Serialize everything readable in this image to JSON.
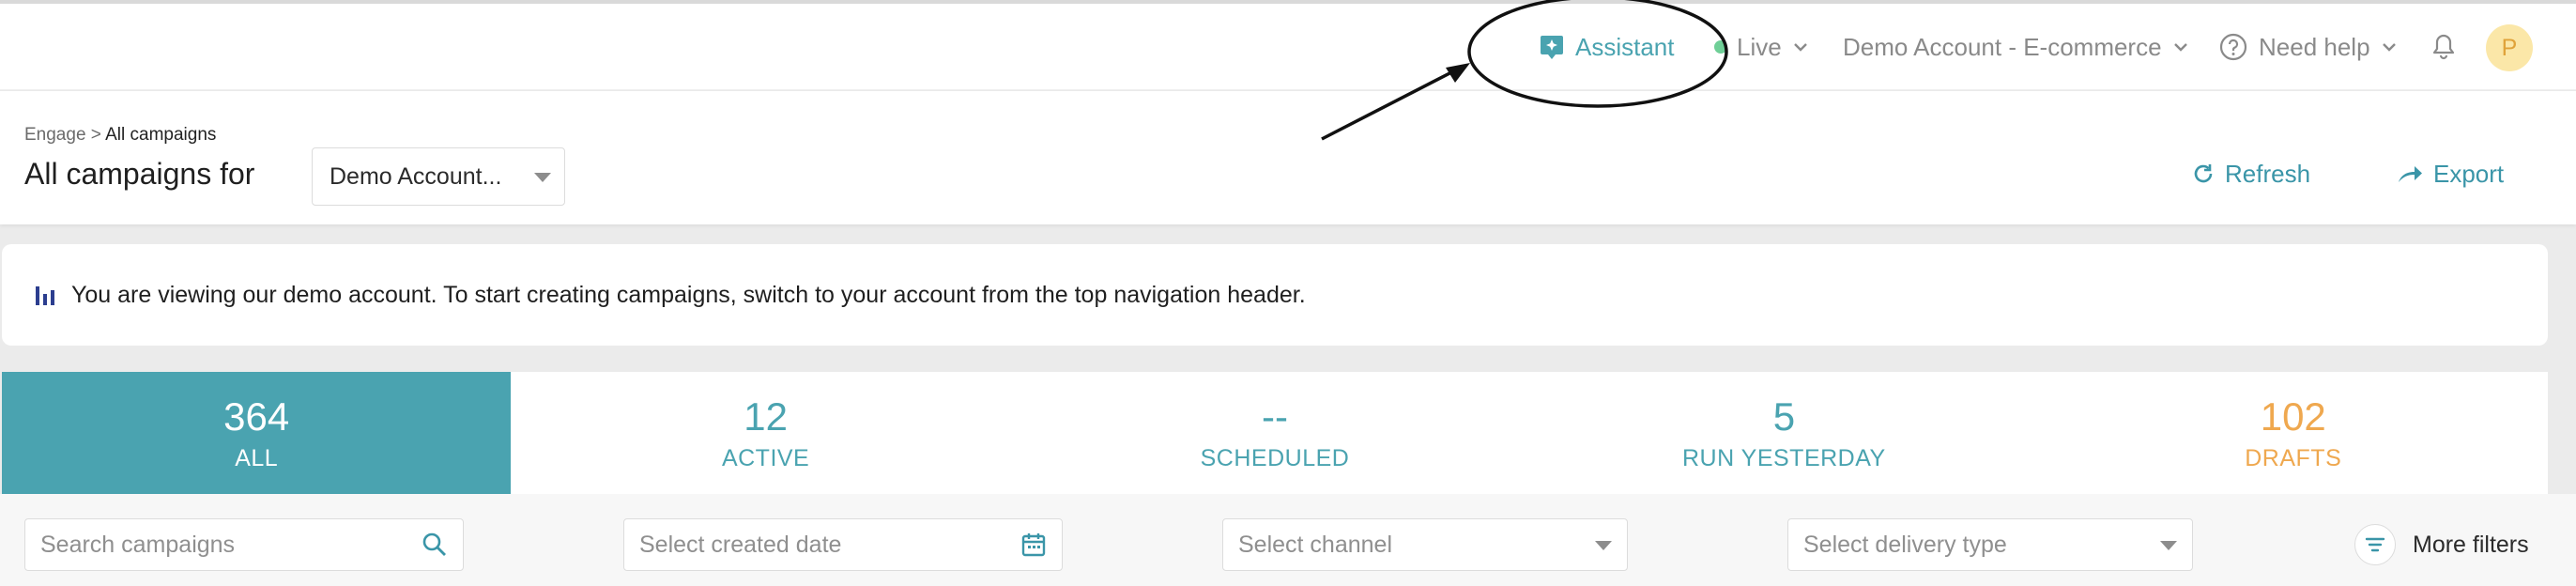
{
  "topbar": {
    "assistant_label": "Assistant",
    "live_label": "Live",
    "account_label": "Demo Account - E-commerce",
    "help_label": "Need help",
    "avatar_initial": "P"
  },
  "subheader": {
    "breadcrumb_parent": "Engage >",
    "breadcrumb_current": "All campaigns",
    "title": "All campaigns for",
    "account_select_value": "Demo Account...",
    "refresh_label": "Refresh",
    "export_label": "Export"
  },
  "banner": {
    "text": "You are viewing our demo account. To start creating campaigns, switch to your account from the top navigation header."
  },
  "stats": [
    {
      "value": "364",
      "label": "ALL"
    },
    {
      "value": "12",
      "label": "ACTIVE"
    },
    {
      "value": "--",
      "label": "SCHEDULED"
    },
    {
      "value": "5",
      "label": "RUN YESTERDAY"
    },
    {
      "value": "102",
      "label": "DRAFTS"
    }
  ],
  "filters": {
    "search_placeholder": "Search campaigns",
    "date_placeholder": "Select created date",
    "channel_placeholder": "Select channel",
    "delivery_placeholder": "Select delivery type",
    "more_filters_label": "More filters"
  },
  "colors": {
    "accent": "#4aa3b0",
    "drafts": "#efa84f",
    "avatar_bg": "#fbe7a8"
  },
  "icons": [
    "assistant-icon",
    "chevron-down-icon",
    "help-circle-icon",
    "bell-icon",
    "refresh-icon",
    "export-arrow-icon",
    "bar-chart-icon",
    "search-icon",
    "calendar-icon",
    "filter-icon"
  ]
}
